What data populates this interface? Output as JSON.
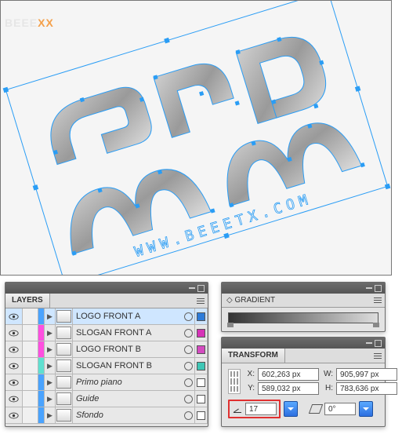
{
  "watermark": {
    "part1": "BEEE",
    "part2": "XX"
  },
  "canvas_url_text": "WWW.BEEETX.COM",
  "layers": {
    "tab": "LAYERS",
    "rows": [
      {
        "name": "LOGO FRONT A",
        "stripe": "#4aa3ff",
        "swatch": "#2d7bd9",
        "selected": true,
        "italic": false
      },
      {
        "name": "SLOGAN FRONT A",
        "stripe": "#ff4fe0",
        "swatch": "#d633b7",
        "selected": false,
        "italic": false
      },
      {
        "name": "LOGO FRONT B",
        "stripe": "#ff4fe0",
        "swatch": "#d44bc0",
        "selected": false,
        "italic": false
      },
      {
        "name": "SLOGAN FRONT B",
        "stripe": "#5fe0d0",
        "swatch": "#3fc7b6",
        "selected": false,
        "italic": false
      },
      {
        "name": "Primo piano",
        "stripe": "#4aa3ff",
        "swatch": "#ffffff",
        "selected": false,
        "italic": true
      },
      {
        "name": "Guide",
        "stripe": "#4aa3ff",
        "swatch": "#ffffff",
        "selected": false,
        "italic": true
      },
      {
        "name": "Sfondo",
        "stripe": "#4aa3ff",
        "swatch": "#ffffff",
        "selected": false,
        "italic": true
      }
    ]
  },
  "gradient": {
    "tab": "GRADIENT"
  },
  "transform": {
    "tab": "TRANSFORM",
    "x": "602,263 px",
    "y": "589,032 px",
    "w": "905,997 px",
    "h": "783,636 px",
    "angle": "17",
    "shear": "0°"
  }
}
